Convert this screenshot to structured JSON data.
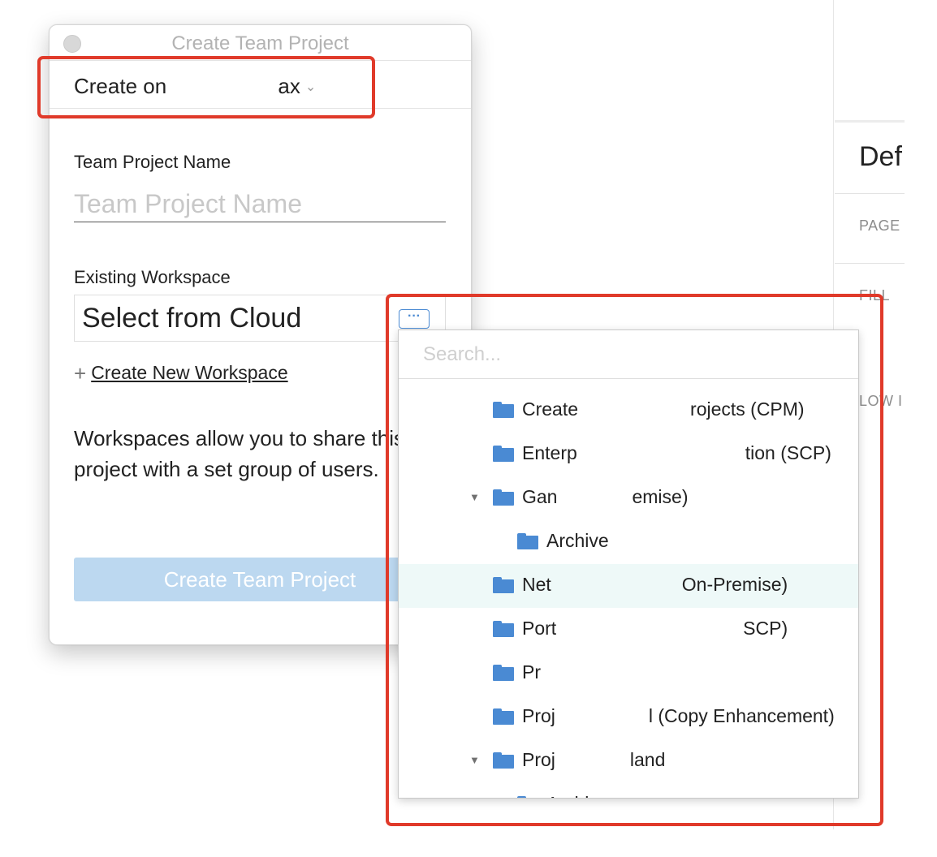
{
  "background": {
    "title": "Def",
    "labels": [
      "PAGE",
      "FILL",
      "LOW I"
    ]
  },
  "dialog": {
    "window_title": "Create Team Project",
    "create_on_label": "Create on",
    "create_on_value": "ax",
    "project_name_label": "Team Project Name",
    "project_name_placeholder": "Team Project Name",
    "workspace_label": "Existing Workspace",
    "workspace_value": "Select from Cloud",
    "more_button_label": "···",
    "create_workspace_link": "Create New Workspace",
    "description": "Workspaces allow you to share this project with a set group of users.",
    "create_button_label": "Create Team Project"
  },
  "popup": {
    "search_placeholder": "Search...",
    "items": [
      {
        "label": "Create      rojects (CPM)",
        "indent": 0,
        "arrow": false
      },
      {
        "label": "Enterp         tion (SCP)",
        "indent": 0,
        "arrow": false
      },
      {
        "label": "Gan    emise)",
        "indent": 0,
        "arrow": true
      },
      {
        "label": "Archive",
        "indent": 1,
        "arrow": false
      },
      {
        "label": "Net       On-Premise)",
        "indent": 0,
        "arrow": false,
        "highlight": true
      },
      {
        "label": "Port          SCP)",
        "indent": 0,
        "arrow": false
      },
      {
        "label": "Pr",
        "indent": 0,
        "arrow": false
      },
      {
        "label": "Proj     l (Copy Enhancement)",
        "indent": 0,
        "arrow": false
      },
      {
        "label": "Proj    land",
        "indent": 0,
        "arrow": true
      },
      {
        "label": "Archive",
        "indent": 1,
        "arrow": false
      }
    ]
  },
  "colors": {
    "accent": "#4a8ad3",
    "annotation": "#e03a2a",
    "disabled_button": "#bcd8f0",
    "row_highlight": "#eef9f8"
  }
}
